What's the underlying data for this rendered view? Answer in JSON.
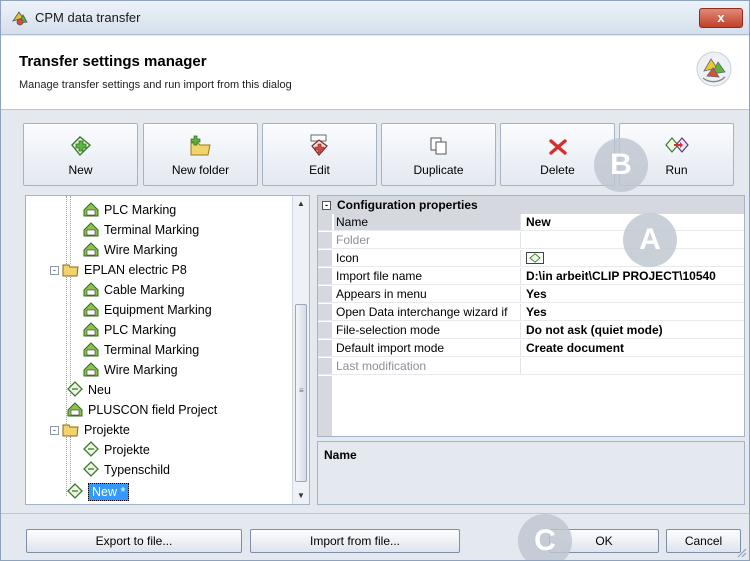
{
  "window": {
    "title": "CPM data transfer",
    "close_label": "x"
  },
  "header": {
    "title": "Transfer settings manager",
    "subtitle": "Manage transfer settings and run import from this dialog"
  },
  "toolbar": {
    "buttons": [
      {
        "label": "New",
        "icon": "new-icon"
      },
      {
        "label": "New folder",
        "icon": "new-folder-icon"
      },
      {
        "label": "Edit",
        "icon": "edit-icon"
      },
      {
        "label": "Duplicate",
        "icon": "duplicate-icon"
      },
      {
        "label": "Delete",
        "icon": "delete-icon"
      },
      {
        "label": "Run",
        "icon": "run-icon"
      }
    ]
  },
  "badges": {
    "a": "A",
    "b": "B",
    "c": "C"
  },
  "tree": {
    "items": [
      {
        "label": "PLC Marking",
        "icon": "marking-icon"
      },
      {
        "label": "Terminal Marking",
        "icon": "marking-icon"
      },
      {
        "label": "Wire Marking",
        "icon": "marking-icon"
      },
      {
        "label": "EPLAN electric P8",
        "icon": "folder-icon",
        "expander": "-"
      },
      {
        "label": "Cable Marking",
        "icon": "marking-icon"
      },
      {
        "label": "Equipment Marking",
        "icon": "marking-icon"
      },
      {
        "label": "PLC Marking",
        "icon": "marking-icon"
      },
      {
        "label": "Terminal Marking",
        "icon": "marking-icon"
      },
      {
        "label": "Wire Marking",
        "icon": "marking-icon"
      },
      {
        "label": "Neu",
        "icon": "setting-icon"
      },
      {
        "label": "PLUSCON field Project",
        "icon": "marking-icon"
      },
      {
        "label": "Projekte",
        "icon": "folder-icon",
        "expander": "-"
      },
      {
        "label": "Projekte",
        "icon": "setting-icon"
      },
      {
        "label": "Typenschild",
        "icon": "setting-icon"
      },
      {
        "label": "New *",
        "icon": "setting-icon",
        "selected": true
      }
    ]
  },
  "properties": {
    "section": "Configuration properties",
    "rows": [
      {
        "name": "Name",
        "value": "New",
        "selected": true
      },
      {
        "name": "Folder",
        "value": "",
        "dim": true
      },
      {
        "name": "Icon",
        "value": "",
        "icon": true
      },
      {
        "name": "Import file name",
        "value": "D:\\in arbeit\\CLIP PROJECT\\10540"
      },
      {
        "name": "Appears in menu",
        "value": "Yes"
      },
      {
        "name": "Open Data interchange wizard if",
        "value": "Yes"
      },
      {
        "name": "File-selection mode",
        "value": "Do not ask (quiet mode)"
      },
      {
        "name": "Default import mode",
        "value": "Create document"
      },
      {
        "name": "Last modification",
        "value": "",
        "dim": true
      }
    ]
  },
  "description": {
    "title": "Name"
  },
  "footer": {
    "export_label": "Export to file...",
    "import_label": "Import from file...",
    "ok_label": "OK",
    "cancel_label": "Cancel"
  },
  "colors": {
    "accent_selected": "#3399ff",
    "badge": "#bec6d0",
    "close": "#c0402a"
  }
}
